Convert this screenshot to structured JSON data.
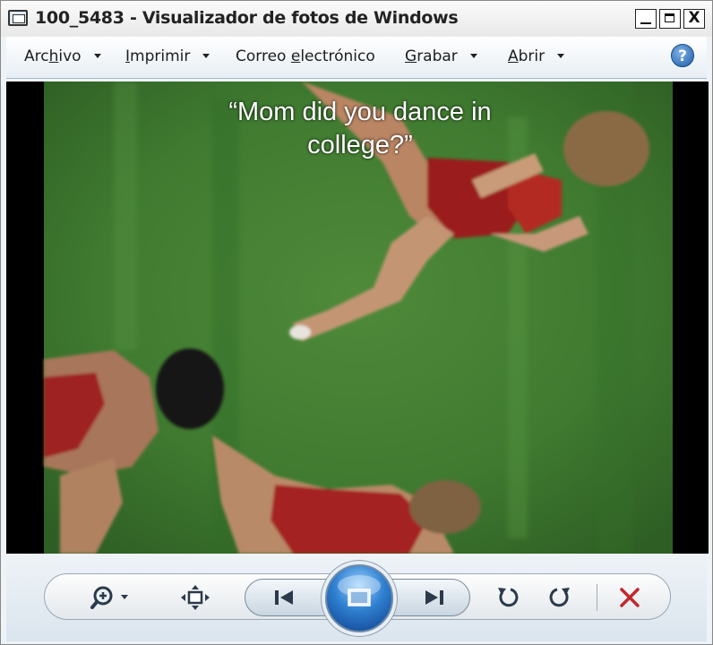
{
  "window": {
    "title": "100_5483 - Visualizador de fotos de Windows",
    "close_glyph": "X"
  },
  "menu": {
    "items": [
      {
        "pre": "Arc",
        "u": "h",
        "post": "ivo",
        "has_dropdown": true
      },
      {
        "pre": "",
        "u": "I",
        "post": "mprimir",
        "has_dropdown": true
      },
      {
        "pre": "Correo ",
        "u": "e",
        "post": "lectrónico",
        "has_dropdown": false
      },
      {
        "pre": "",
        "u": "G",
        "post": "rabar",
        "has_dropdown": true
      },
      {
        "pre": "",
        "u": "A",
        "post": "brir",
        "has_dropdown": true
      }
    ],
    "help_glyph": "?"
  },
  "photo": {
    "caption": "“Mom did you dance in college?”"
  },
  "toolbar": {
    "icons": [
      "zoom-icon",
      "fit-window-icon",
      "previous-icon",
      "slideshow-icon",
      "next-icon",
      "rotate-left-icon",
      "rotate-right-icon",
      "delete-icon"
    ],
    "colors": {
      "accent": "#2f80d0",
      "delete": "#c0282c",
      "icon": "#2b3a4a"
    }
  }
}
